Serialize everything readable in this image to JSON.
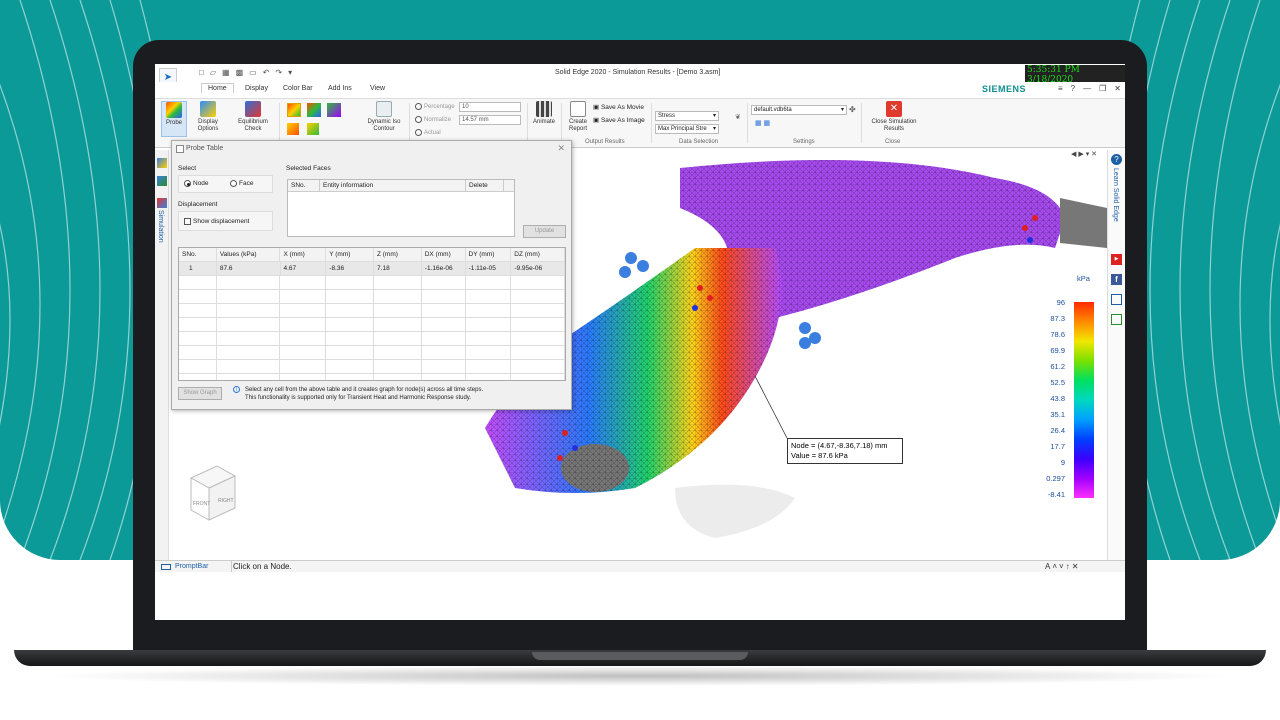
{
  "window": {
    "title": "Solid Edge 2020 - Simulation Results - [Demo 3.asm]",
    "clock": "5:35:31 PM 3/18/2020",
    "brand": "SIEMENS"
  },
  "menu": {
    "tabs": [
      {
        "label": "Home"
      },
      {
        "label": "Display"
      },
      {
        "label": "Color Bar"
      },
      {
        "label": "Add Ins"
      },
      {
        "label": "View"
      }
    ]
  },
  "ribbon": {
    "probe": "Probe",
    "display_options": [
      "Display",
      "Options"
    ],
    "equilibrium_check": [
      "Equilibrium",
      "Check"
    ],
    "dynamic_iso": [
      "Dynamic Iso",
      "Contour"
    ],
    "percentage_label": "Percentage",
    "percentage_value": "10",
    "normalize_label": "Normalize",
    "normalize_value": "14.57 mm",
    "actual_label": "Actual",
    "animate": "Animate",
    "create_report": [
      "Create",
      "Report"
    ],
    "save_as_movie": "Save As Movie",
    "save_as_image": "Save As Image",
    "output_results_label": "Output Results",
    "data_sel_1": "Stress",
    "data_sel_2": "Max Principal Stre",
    "data_selection_label": "Data Selection",
    "settings_value": "default.vdb6ta",
    "settings_label": "Settings",
    "close_sim": [
      "Close Simulation",
      "Results"
    ],
    "close_label": "Close"
  },
  "side": {
    "left_label": "Simulation",
    "right_label": "Learn Solid Edge"
  },
  "probe_table": {
    "title": "Probe Table",
    "select_label": "Select",
    "node_label": "Node",
    "face_label": "Face",
    "displacement_label": "Displacement",
    "show_displacement": "Show displacement",
    "selected_faces_label": "Selected Faces",
    "sf_columns": [
      "SNo.",
      "Entity information",
      "Delete"
    ],
    "update_button": "Update",
    "columns": [
      "SNo.",
      "Values (kPa)",
      "X (mm)",
      "Y (mm)",
      "Z (mm)",
      "DX (mm)",
      "DY (mm)",
      "DZ (mm)"
    ],
    "rows": [
      [
        "1",
        "87.6",
        "4.67",
        "-8.36",
        "7.18",
        "-1.16e-06",
        "-1.11e-05",
        "-9.95e-06"
      ]
    ],
    "show_graph_button": "Show Graph",
    "info_line1": "Select any cell from the above table and it creates graph for node(s) across all time steps.",
    "info_line2": "This functionality is supported only for Transient Heat and Harmonic Response study."
  },
  "callout": {
    "line1": "Node = (4.67,-8.36,7.18) mm",
    "line2": "Value = 87.6 kPa"
  },
  "colorbar": {
    "unit": "kPa",
    "labels": [
      "96",
      "87.3",
      "78.6",
      "69.9",
      "61.2",
      "52.5",
      "43.8",
      "35.1",
      "26.4",
      "17.7",
      "9",
      "0.297",
      "-8.41"
    ]
  },
  "viewcube": {
    "front": "FRONT",
    "right": "RIGHT"
  },
  "promptbar": {
    "label": "PromptBar",
    "message": "Click on a Node."
  }
}
